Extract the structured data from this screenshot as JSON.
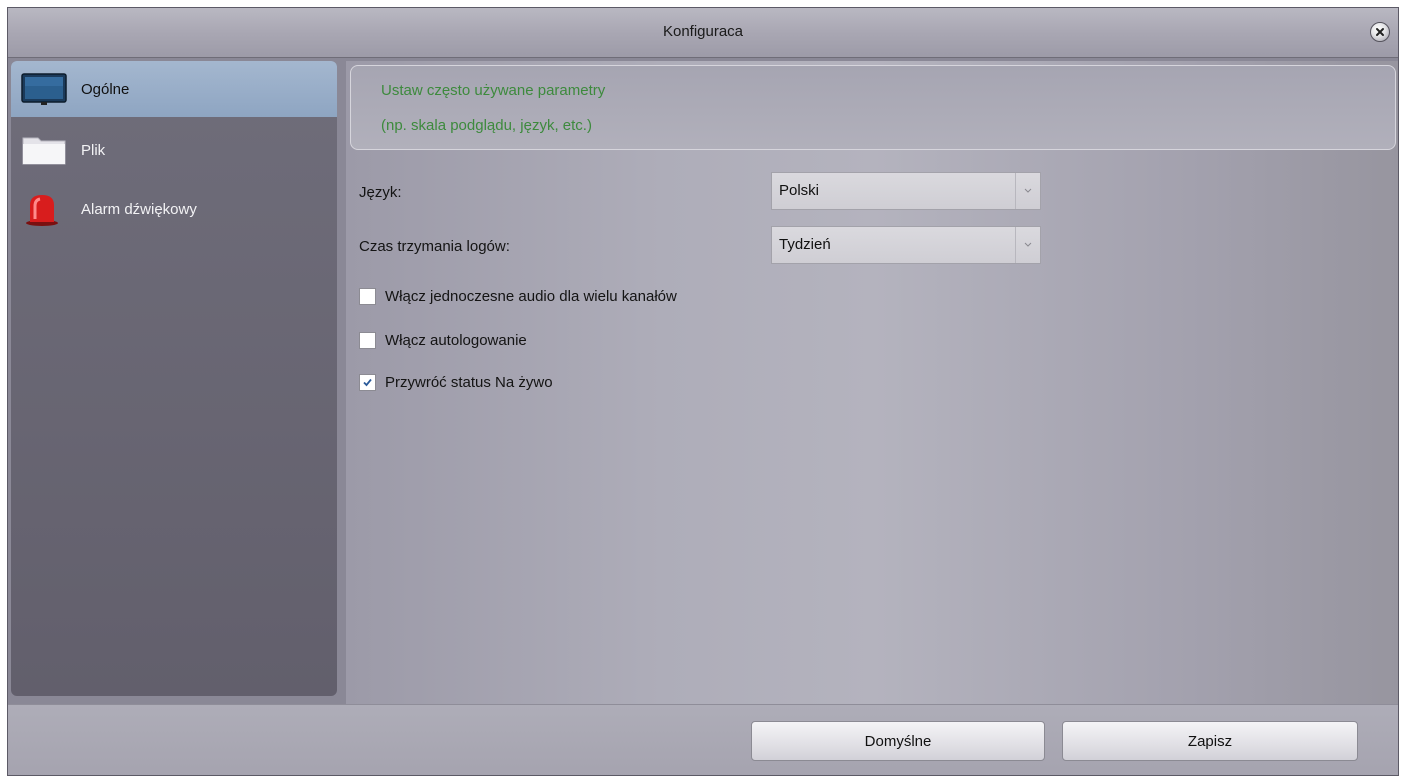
{
  "window": {
    "title": "Konfiguraca",
    "close_icon": "close-icon"
  },
  "sidebar": {
    "items": [
      {
        "label": "Ogólne",
        "icon": "monitor-icon",
        "selected": true
      },
      {
        "label": "Plik",
        "icon": "folder-icon",
        "selected": false
      },
      {
        "label": "Alarm dźwiękowy",
        "icon": "alarm-siren-icon",
        "selected": false
      }
    ]
  },
  "info": {
    "line1": "Ustaw często używane parametry",
    "line2": "(np. skala podglądu, język, etc.)"
  },
  "form": {
    "language_label": "Język:",
    "language_value": "Polski",
    "log_label": "Czas trzymania logów:",
    "log_value": "Tydzień"
  },
  "checkboxes": [
    {
      "label": "Włącz jednoczesne audio dla wielu kanałów",
      "checked": false
    },
    {
      "label": "Włącz autologowanie",
      "checked": false
    },
    {
      "label": "Przywróć status Na żywo",
      "checked": true
    }
  ],
  "footer": {
    "default_label": "Domyślne",
    "save_label": "Zapisz"
  },
  "colors": {
    "accent_text": "#3d8a3d",
    "selection": "#9aaecb"
  }
}
